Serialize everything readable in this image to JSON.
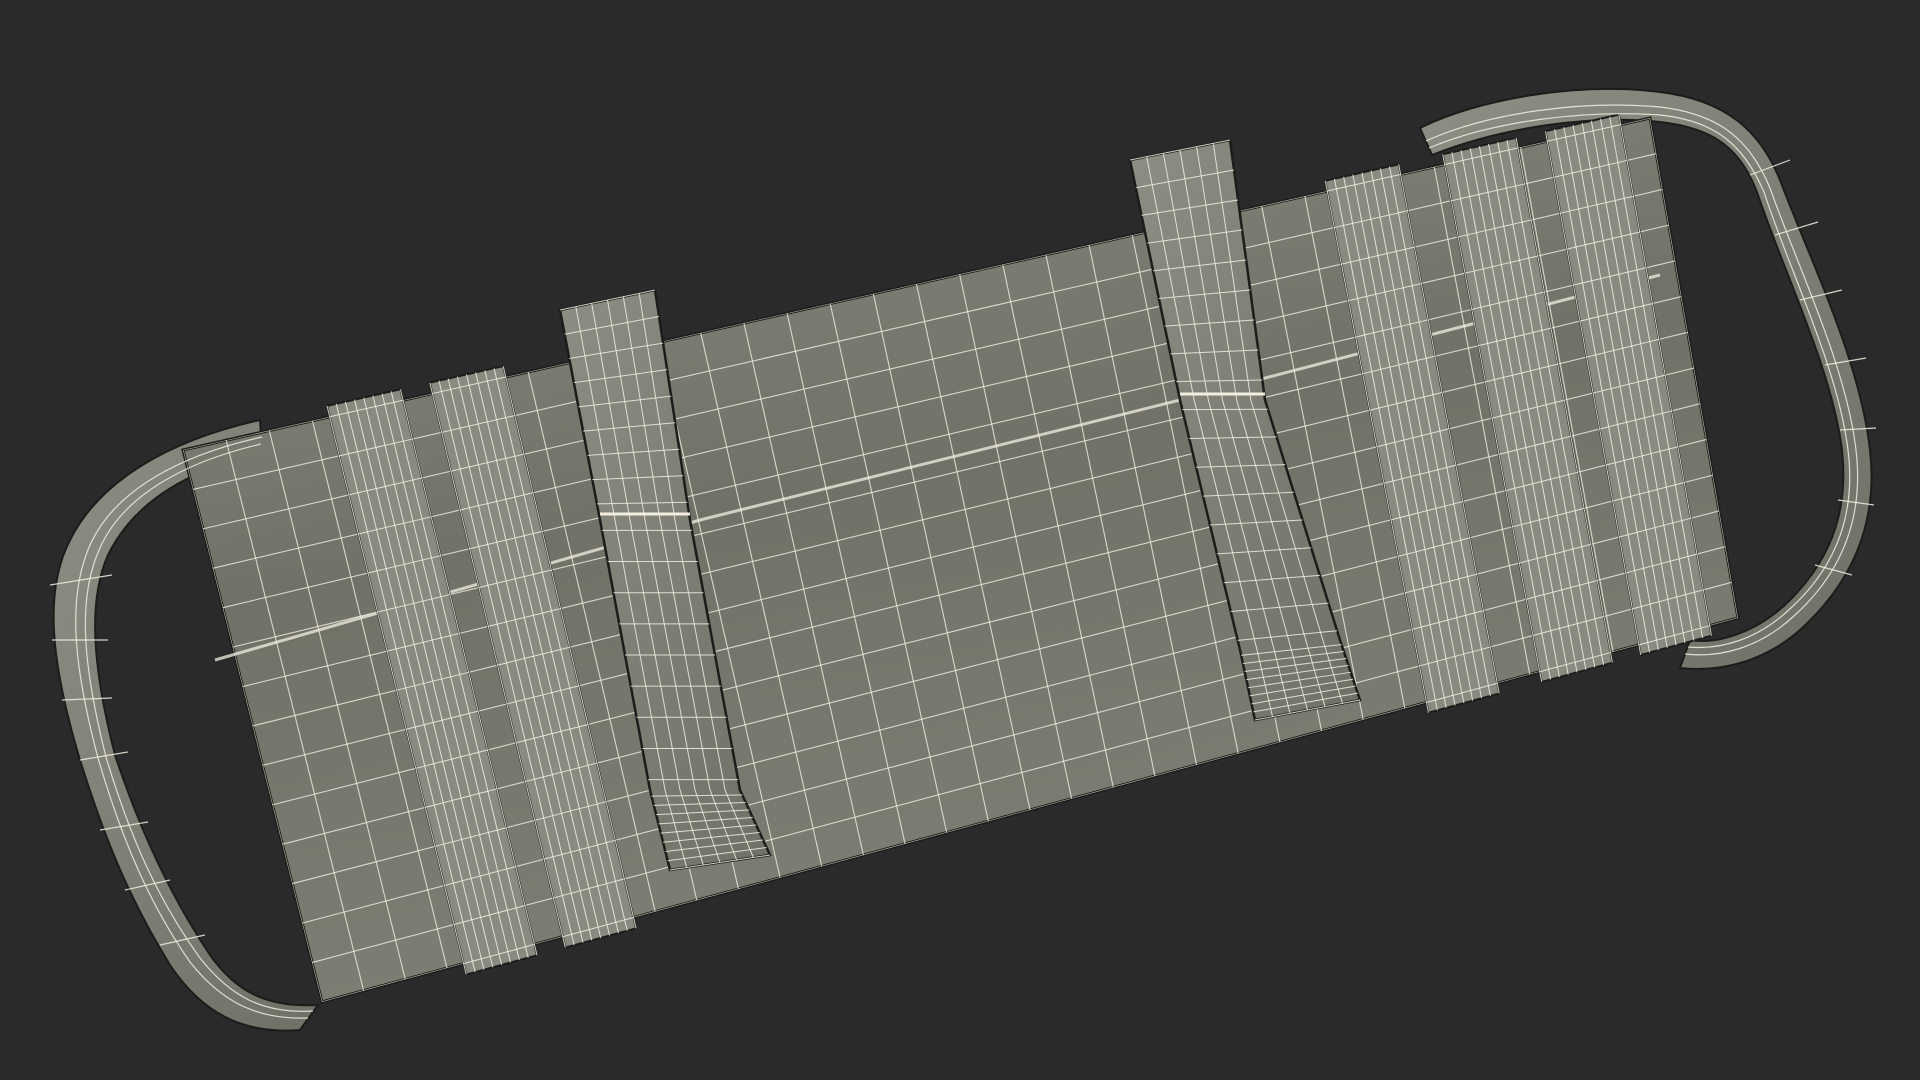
{
  "scene": {
    "subject": "wireframe-sandbag",
    "colors": {
      "background": "#2a2a2a",
      "body_fill": "#74756b",
      "body_fill_light": "#8a8b80",
      "body_fill_dark": "#5d5e55",
      "wire": "#f2efe0",
      "outline": "#1c1c1a"
    }
  }
}
